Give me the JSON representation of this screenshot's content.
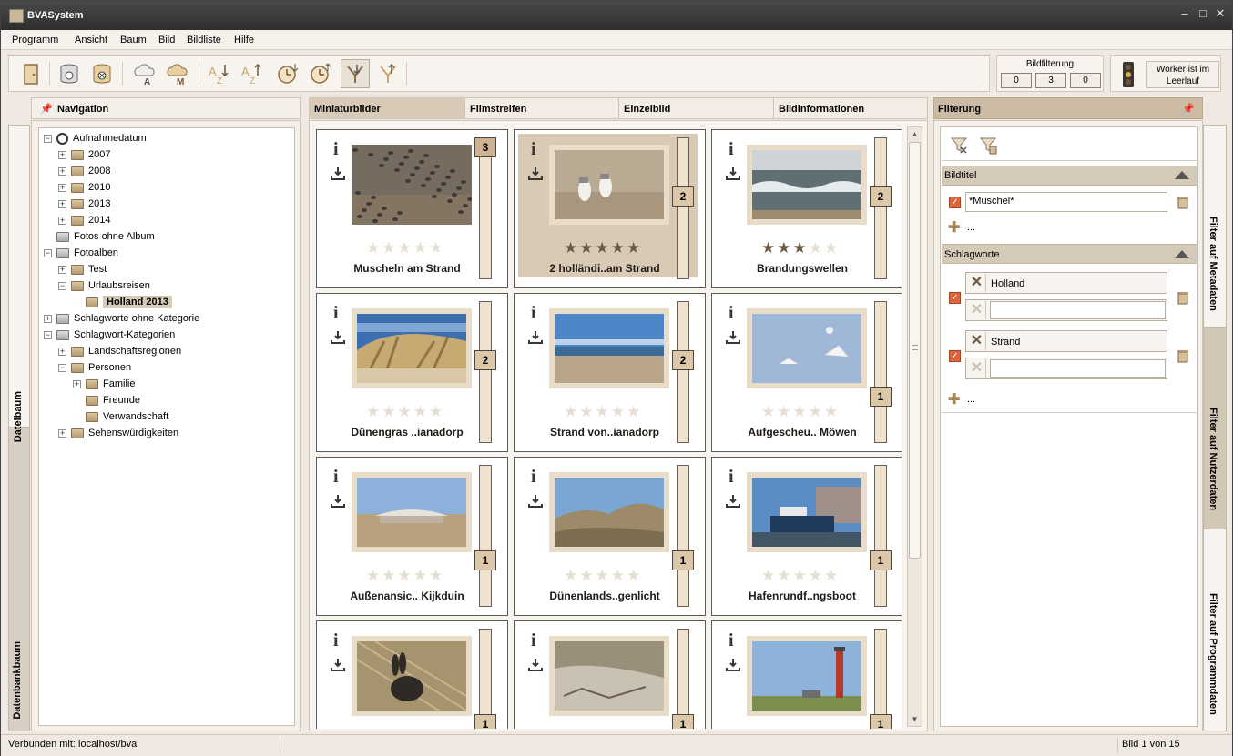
{
  "window": {
    "title": "BVASystem"
  },
  "menu": [
    "Programm",
    "Ansicht",
    "Baum",
    "Bild",
    "Bildliste",
    "Hilfe"
  ],
  "toolbar": {
    "buttons": [
      "exit-icon",
      "database-connect-icon",
      "database-disconnect-icon",
      "cloud-album-icon",
      "cloud-metadata-icon",
      "sort-az-icon",
      "sort-za-icon",
      "sort-date-asc-icon",
      "sort-date-desc-icon",
      "filter-apply-icon",
      "filter-branch-icon"
    ]
  },
  "bildfilterung": {
    "label": "Bildfilterung",
    "counts": [
      "0",
      "3",
      "0"
    ]
  },
  "worker": {
    "status": "Worker ist im Leerlauf"
  },
  "left_tabs": {
    "top": "Dateibaum",
    "bottom": "Datenbankbaum"
  },
  "navigation": {
    "title": "Navigation",
    "tree": [
      {
        "label": "Aufnahmedatum",
        "level": 0,
        "expander": "minus",
        "icon": "clock"
      },
      {
        "label": "2007",
        "level": 1,
        "expander": "plus",
        "icon": "folder"
      },
      {
        "label": "2008",
        "level": 1,
        "expander": "plus",
        "icon": "folder"
      },
      {
        "label": "2010",
        "level": 1,
        "expander": "plus",
        "icon": "folder"
      },
      {
        "label": "2013",
        "level": 1,
        "expander": "plus",
        "icon": "folder"
      },
      {
        "label": "2014",
        "level": 1,
        "expander": "plus",
        "icon": "folder"
      },
      {
        "label": "Fotos ohne Album",
        "level": 0,
        "expander": "none",
        "icon": "photo"
      },
      {
        "label": "Fotoalben",
        "level": 0,
        "expander": "minus",
        "icon": "photo"
      },
      {
        "label": "Test",
        "level": 1,
        "expander": "plus",
        "icon": "folder"
      },
      {
        "label": "Urlaubsreisen",
        "level": 1,
        "expander": "minus",
        "icon": "folder"
      },
      {
        "label": "Holland 2013",
        "level": 2,
        "expander": "none",
        "icon": "folder",
        "selected": true
      },
      {
        "label": "Schlagworte ohne Kategorie",
        "level": 0,
        "expander": "plus",
        "icon": "tags"
      },
      {
        "label": "Schlagwort-Kategorien",
        "level": 0,
        "expander": "minus",
        "icon": "tags"
      },
      {
        "label": "Landschaftsregionen",
        "level": 1,
        "expander": "plus",
        "icon": "folder"
      },
      {
        "label": "Personen",
        "level": 1,
        "expander": "minus",
        "icon": "folder"
      },
      {
        "label": "Familie",
        "level": 2,
        "expander": "plus",
        "icon": "folder"
      },
      {
        "label": "Freunde",
        "level": 2,
        "expander": "none",
        "icon": "folder"
      },
      {
        "label": "Verwandschaft",
        "level": 2,
        "expander": "none",
        "icon": "folder"
      },
      {
        "label": "Sehenswürdigkeiten",
        "level": 1,
        "expander": "plus",
        "icon": "folder"
      }
    ]
  },
  "center_tabs": [
    "Miniaturbilder",
    "Filmstreifen",
    "Einzelbild",
    "Bildinformationen"
  ],
  "thumbnails": [
    {
      "name": "Muscheln am Strand",
      "rating": 0,
      "count": "3",
      "level": 1.0,
      "selected": false,
      "framed": false,
      "scene": "mussels"
    },
    {
      "name": "2 holländi..am Strand",
      "rating": 5,
      "count": "2",
      "level": 0.6,
      "selected": true,
      "framed": true,
      "scene": "gulls"
    },
    {
      "name": "Brandungswellen",
      "rating": 3,
      "count": "2",
      "level": 0.6,
      "selected": false,
      "framed": true,
      "scene": "waves"
    },
    {
      "name": "Dünengras ..ianadorp",
      "rating": 0,
      "count": "2",
      "level": 0.6,
      "selected": false,
      "framed": true,
      "scene": "dunegrass"
    },
    {
      "name": "Strand von..ianadorp",
      "rating": 0,
      "count": "2",
      "level": 0.6,
      "selected": false,
      "framed": true,
      "scene": "beach"
    },
    {
      "name": "Aufgescheu.. Möwen",
      "rating": 0,
      "count": "1",
      "level": 0.3,
      "selected": false,
      "framed": true,
      "scene": "flyinggulls"
    },
    {
      "name": "Außenansic.. Kijkduin",
      "rating": 0,
      "count": "1",
      "level": 0.3,
      "selected": false,
      "framed": true,
      "scene": "building"
    },
    {
      "name": "Dünenlands..genlicht",
      "rating": 0,
      "count": "1",
      "level": 0.3,
      "selected": false,
      "framed": true,
      "scene": "dunes"
    },
    {
      "name": "Hafenrundf..ngsboot",
      "rating": 0,
      "count": "1",
      "level": 0.3,
      "selected": false,
      "framed": true,
      "scene": "harbor"
    },
    {
      "name": "",
      "rating": 0,
      "count": "1",
      "level": 0.3,
      "selected": false,
      "framed": true,
      "scene": "rabbit"
    },
    {
      "name": "",
      "rating": 0,
      "count": "1",
      "level": 0.3,
      "selected": false,
      "framed": true,
      "scene": "dunes2"
    },
    {
      "name": "",
      "rating": 0,
      "count": "1",
      "level": 0.3,
      "selected": false,
      "framed": true,
      "scene": "lighthouse"
    }
  ],
  "filter": {
    "title": "Filterung",
    "bildtitel": {
      "label": "Bildtitel",
      "value": "*Muschel*",
      "more": "..."
    },
    "schlagworte": {
      "label": "Schlagworte",
      "groups": [
        {
          "keyword": "Holland",
          "input": ""
        },
        {
          "keyword": "Strand",
          "input": ""
        }
      ],
      "more": "..."
    }
  },
  "right_tabs": [
    "Filter auf Metadaten",
    "Filter auf Nutzerdaten",
    "Filter auf Programmdaten"
  ],
  "status": {
    "connection": "Verbunden mit: localhost/bva",
    "position": "Bild 1 von 15"
  }
}
